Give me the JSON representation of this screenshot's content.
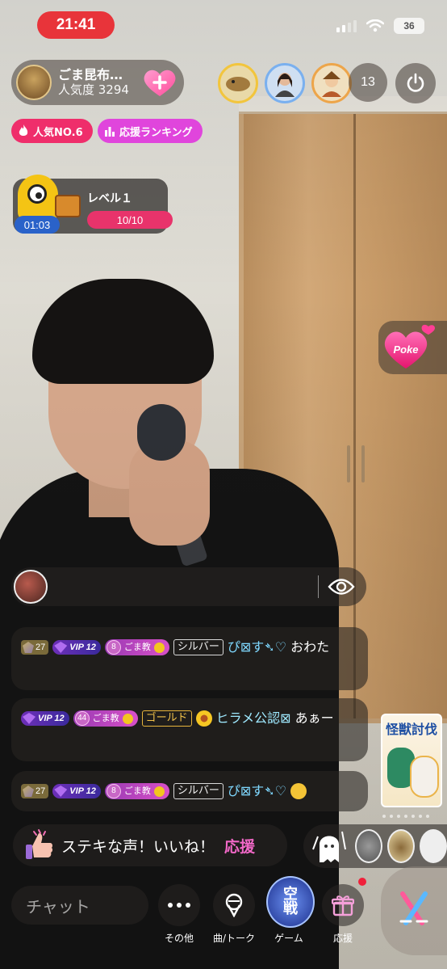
{
  "status_bar": {
    "time": "21:41",
    "battery": "36"
  },
  "host": {
    "name": "ごま昆布…",
    "popularity": "人気度 3294"
  },
  "viewer_count": "13",
  "badges": {
    "rank": "人気NO.6",
    "support_ranking": "応援ランキング"
  },
  "level": {
    "timer": "01:03",
    "title": "レベル１",
    "progress": "10/10"
  },
  "poke": {
    "label": "Poke"
  },
  "chat": {
    "messages": [
      {
        "level": "27",
        "vip": "VIP 12",
        "fan_level": "8",
        "fan_club": "ごま教",
        "rank": "シルバー",
        "nickname": "ぴ⊠す➴♡",
        "text": "おわた"
      },
      {
        "vip": "VIP 12",
        "fan_level": "44",
        "fan_club": "ごま教",
        "rank": "ゴールド",
        "nickname": "ヒラメ公認⊠",
        "text": "あぁー"
      },
      {
        "level": "27",
        "vip": "VIP 12",
        "fan_level": "8",
        "fan_club": "ごま教",
        "rank": "シルバー",
        "nickname": "ぴ⊠す➴♡",
        "text": ""
      }
    ]
  },
  "event": {
    "title": "怪獣討伐"
  },
  "quick_reaction": {
    "text": "ステキな声！いいね！",
    "support": "応援"
  },
  "bottom_bar": {
    "chat_placeholder": "チャット",
    "more_label": "その他",
    "song_talk_label": "曲/トーク",
    "game_label": "ゲーム",
    "game_icon_text": "空戦",
    "gift_label": "応援"
  },
  "colors": {
    "accent_pink": "#ef2e6b",
    "accent_magenta": "#e045dc",
    "level_progress": "#e8336b",
    "time_pill": "#e8343a"
  }
}
